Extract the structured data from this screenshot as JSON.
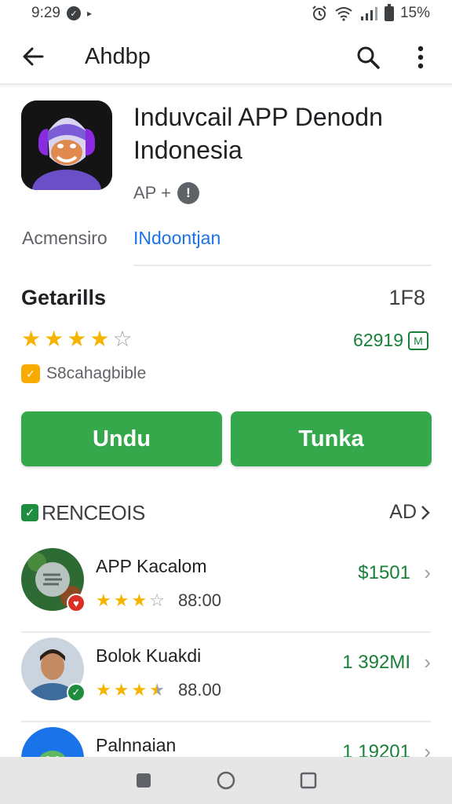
{
  "status_bar": {
    "time": "9:29",
    "battery": "15%"
  },
  "app_bar": {
    "title": "Ahdbp"
  },
  "app": {
    "name": "Induvcail APP Denodn Indonesia",
    "developer": "AP +",
    "category_label": "Acmensiro",
    "category_link": "INdoontjan",
    "icon_name": "app-logo-icon"
  },
  "details": {
    "title": "Getarills",
    "rating_count": "1F8",
    "rating_stars": 4,
    "downloads": "62919",
    "downloads_icon": "M",
    "content_rating": "S8cahagbible"
  },
  "buttons": {
    "install": "Undu",
    "open": "Tunka"
  },
  "recommendations": {
    "title": "RENCEOIS",
    "more": "AD",
    "items": [
      {
        "name": "APP Kacalom",
        "rating": "88:00",
        "price": "$1501",
        "stars": 3
      },
      {
        "name": "Bolok Kuakdi",
        "rating": "88.00",
        "price": "1 392MI",
        "stars": 3.5
      },
      {
        "name": "Palnnaian",
        "rating": "",
        "price": "1 19201",
        "stars": 0
      }
    ]
  },
  "colors": {
    "accent_green": "#34a84a",
    "link_blue": "#1a73e8",
    "star_yellow": "#f4b400"
  }
}
